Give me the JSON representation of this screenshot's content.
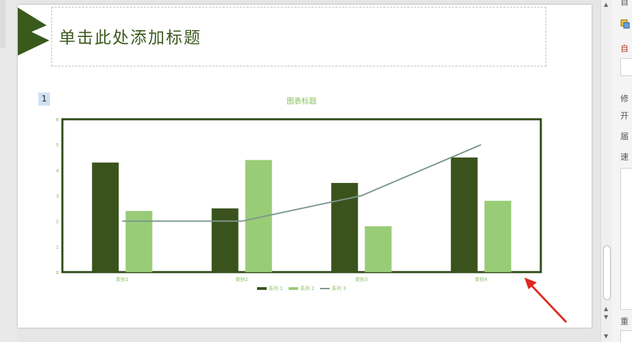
{
  "slide": {
    "title_placeholder": "单击此处添加标题",
    "slide_number": "1"
  },
  "chart_data": {
    "type": "bar",
    "title": "图表标题",
    "categories": [
      "类别1",
      "类别2",
      "类别3",
      "类别4"
    ],
    "series": [
      {
        "name": "系列 1",
        "type": "bar",
        "values": [
          4.3,
          2.5,
          3.5,
          4.5
        ],
        "color": "#3a531d"
      },
      {
        "name": "系列 2",
        "type": "bar",
        "values": [
          2.4,
          4.4,
          1.8,
          2.8
        ],
        "color": "#99cc77"
      },
      {
        "name": "系列 3",
        "type": "line",
        "values": [
          2,
          2,
          3,
          5
        ],
        "color": "#7b978c"
      }
    ],
    "ylim": [
      0,
      6
    ],
    "yticks": [
      "0",
      "1",
      "2",
      "3",
      "4",
      "5",
      "6"
    ],
    "legend_position": "bottom",
    "grid": false
  },
  "right_panel": {
    "labels": [
      "自",
      "自",
      "修",
      "开",
      "届",
      "速",
      "重"
    ]
  },
  "colors": {
    "title_green": "#3b5a1f",
    "chart_text": "#8dc063",
    "frame": "#2e4a17",
    "arrow": "#e02a20"
  }
}
